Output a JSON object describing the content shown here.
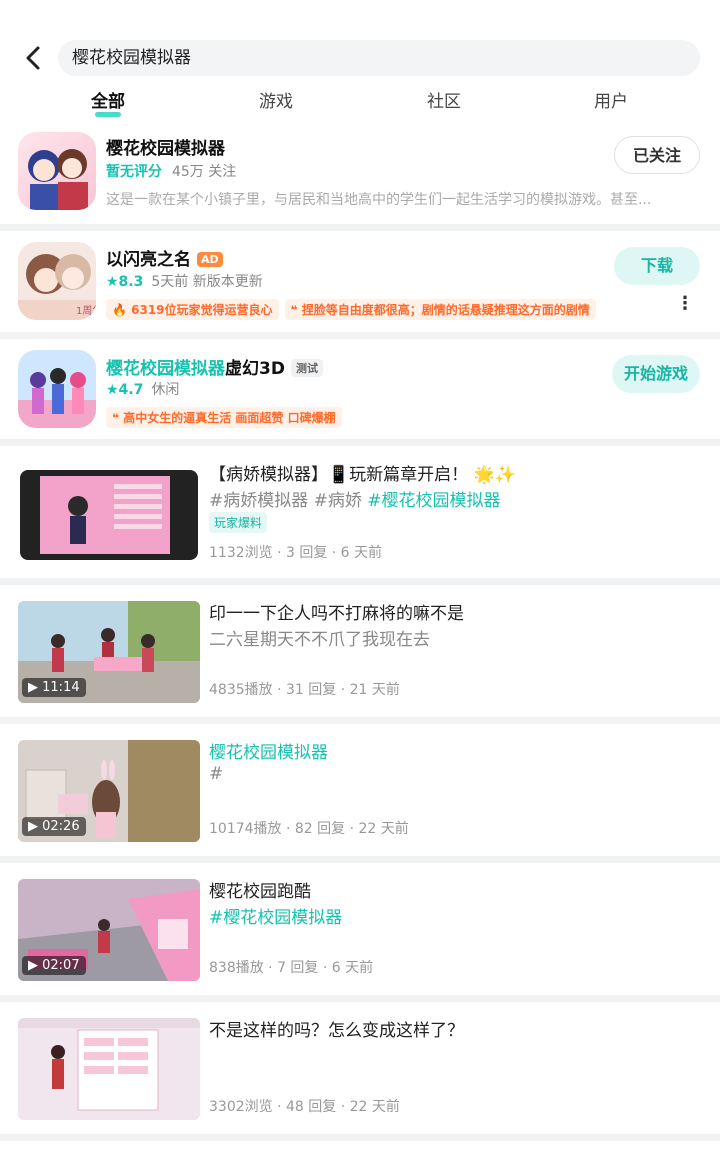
{
  "search": {
    "query": "樱花校园模拟器"
  },
  "tabs": [
    {
      "label": "全部",
      "active": true
    },
    {
      "label": "游戏"
    },
    {
      "label": "社区"
    },
    {
      "label": "用户"
    }
  ],
  "apps": [
    {
      "name": "樱花校园模拟器",
      "score_text": "暂无评分",
      "meta": "45万 关注",
      "desc": "这是一款在某个小镇子里，与居民和当地高中的学生们一起生活学习的模拟游戏。甚至...",
      "button": "已关注"
    },
    {
      "name": "以闪亮之名",
      "badge": "AD",
      "score": "★8.3",
      "meta": "5天前 新版本更新",
      "tags": [
        "🔥 6319位玩家觉得运营良心",
        "❝ 捏脸等自由度都很高；剧情的话悬疑推理这方面的剧情"
      ],
      "button": "下载",
      "more": "⋮"
    },
    {
      "name_hl": "樱花校园模拟器",
      "name_rest": "虚幻3D",
      "badge": "测试",
      "score": "★4.7",
      "meta": "休闲",
      "tags": [
        "❝ 高中女生的逼真生活 画面超赞 口碑爆棚"
      ],
      "button": "开始游戏"
    }
  ],
  "posts": [
    {
      "title": "【病娇模拟器】📱玩新篇章开启！ 🌟✨",
      "sub_plain": "#病娇模拟器 #病娇 ",
      "sub_hl": "#樱花校园模拟器",
      "chip": "玩家爆料",
      "stats": "1132浏览 · 3 回复 · 6 天前"
    },
    {
      "title": "印一一下企人吗不打麻将的嘛不是",
      "sub_plain": "二六星期天不不爪了我现在去",
      "duration": "▶ 11:14",
      "stats": "4835播放 · 31 回复 · 21 天前"
    },
    {
      "title_hl": "樱花校园模拟器",
      "sub_plain": "#",
      "duration": "▶ 02:26",
      "stats": "10174播放 · 82 回复 · 22 天前"
    },
    {
      "title": "樱花校园跑酷",
      "sub_hl": "#樱花校园模拟器",
      "duration": "▶ 02:07",
      "stats": "838播放 · 7 回复 · 6 天前"
    },
    {
      "title": "不是这样的吗？怎么变成这样了？",
      "stats": "3302浏览 · 48 回复 · 22 天前"
    }
  ],
  "colors": {
    "accent": "#16c2b0",
    "tag_orange": "#ff6a2b",
    "separator": "#f1f2f4"
  }
}
